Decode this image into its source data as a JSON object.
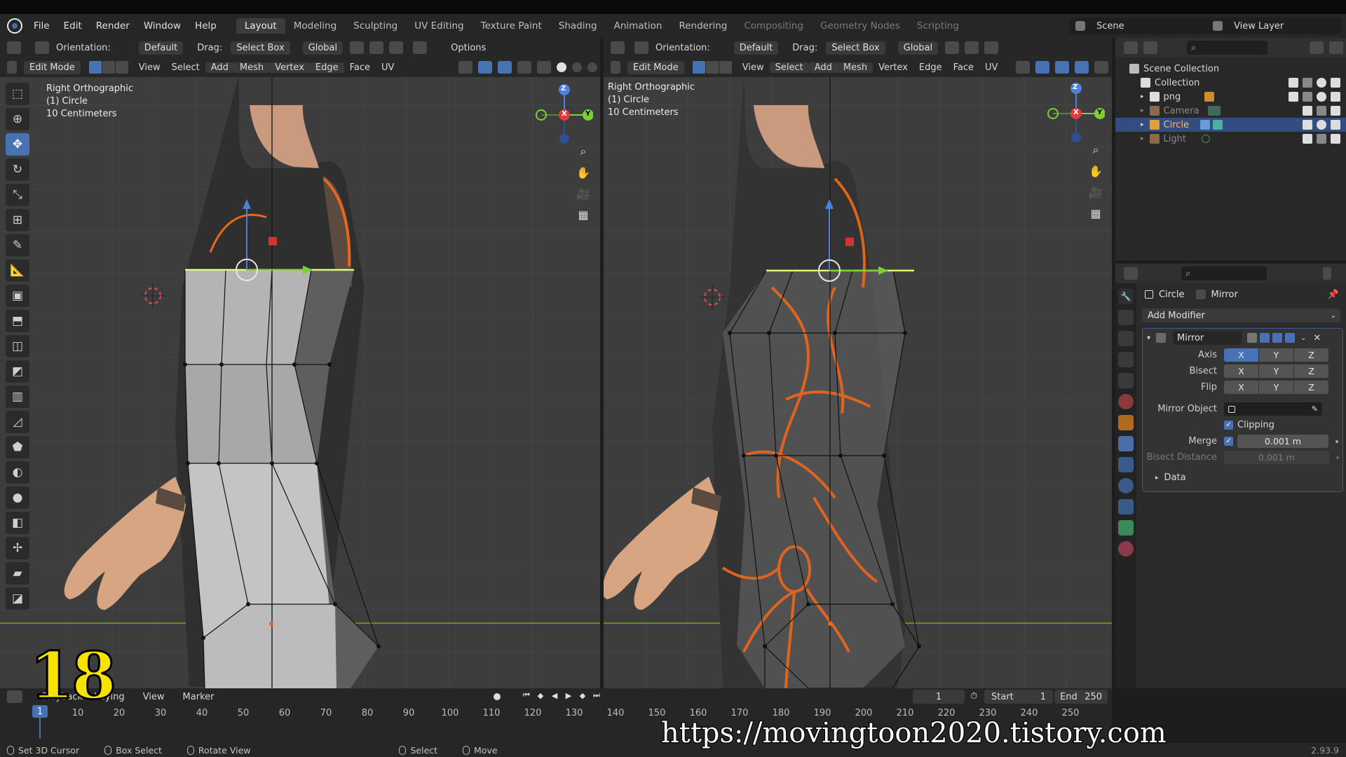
{
  "topbar": {
    "menus": [
      "File",
      "Edit",
      "Render",
      "Window",
      "Help"
    ],
    "workspaces": [
      "Layout",
      "Modeling",
      "Sculpting",
      "UV Editing",
      "Texture Paint",
      "Shading",
      "Animation",
      "Rendering",
      "Compositing",
      "Geometry Nodes",
      "Scripting"
    ],
    "active_workspace": "Layout",
    "scene": "Scene",
    "view_layer": "View Layer"
  },
  "viewport_left": {
    "orientation_label": "Orientation:",
    "orientation_value": "Default",
    "drag_label": "Drag:",
    "drag_value": "Select Box",
    "transform": "Global",
    "options_label": "Options",
    "mode": "Edit Mode",
    "menus": [
      "View",
      "Select",
      "Add",
      "Mesh",
      "Vertex",
      "Edge",
      "Face",
      "UV"
    ],
    "view_name": "Right Orthographic",
    "object_line": "(1) Circle",
    "scale_line": "10 Centimeters"
  },
  "viewport_right": {
    "orientation_label": "Orientation:",
    "orientation_value": "Default",
    "drag_label": "Drag:",
    "drag_value": "Select Box",
    "transform": "Global",
    "mode": "Edit Mode",
    "menus": [
      "View",
      "Select",
      "Add",
      "Mesh",
      "Vertex",
      "Edge",
      "Face",
      "UV"
    ],
    "view_name": "Right Orthographic",
    "object_line": "(1) Circle",
    "scale_line": "10 Centimeters"
  },
  "gizmo": {
    "z": "Z",
    "y": "Y",
    "x": "X"
  },
  "outliner": {
    "items": [
      {
        "label": "Scene Collection",
        "icon": "scene-collection-icon",
        "selected": false
      },
      {
        "label": "Collection",
        "icon": "collection-icon",
        "selected": false
      },
      {
        "label": "png",
        "icon": "image-empty-icon",
        "selected": false
      },
      {
        "label": "Camera",
        "icon": "camera-icon",
        "selected": false
      },
      {
        "label": "Circle",
        "icon": "mesh-icon",
        "selected": true
      },
      {
        "label": "Light",
        "icon": "light-icon",
        "selected": false
      }
    ]
  },
  "properties": {
    "object_name": "Circle",
    "modifier_crumb": "Mirror",
    "add_modifier": "Add Modifier",
    "modifier_name": "Mirror",
    "axis_label": "Axis",
    "bisect_label": "Bisect",
    "flip_label": "Flip",
    "axes": [
      "X",
      "Y",
      "Z"
    ],
    "mirror_object_label": "Mirror Object",
    "clipping_label": "Clipping",
    "merge_label": "Merge",
    "merge_value": "0.001 m",
    "bisect_distance_label": "Bisect Distance",
    "bisect_distance_value": "0.001 m",
    "data_label": "Data"
  },
  "timeline": {
    "playback": "Playback",
    "keying": "Keying",
    "view": "View",
    "marker": "Marker",
    "current_frame": "1",
    "start_label": "Start",
    "start_value": "1",
    "end_label": "End",
    "end_value": "250",
    "ruler": [
      "10",
      "20",
      "30",
      "40",
      "50",
      "60",
      "70",
      "80",
      "90",
      "100",
      "110",
      "120",
      "130",
      "140",
      "150",
      "160",
      "170",
      "180",
      "190",
      "200",
      "210",
      "220",
      "230",
      "240",
      "250"
    ]
  },
  "statusbar": {
    "items": [
      "Set 3D Cursor",
      "Box Select",
      "Rotate View",
      "Select",
      "Move"
    ],
    "version": "2.93.9"
  },
  "overlay": {
    "frame_number": "18",
    "watermark": "https://movingtoon2020.tistory.com"
  },
  "colors": {
    "accent": "#4772b3",
    "viewport_bg": "#3d3d3d",
    "suit_orange": "#e8661e"
  }
}
